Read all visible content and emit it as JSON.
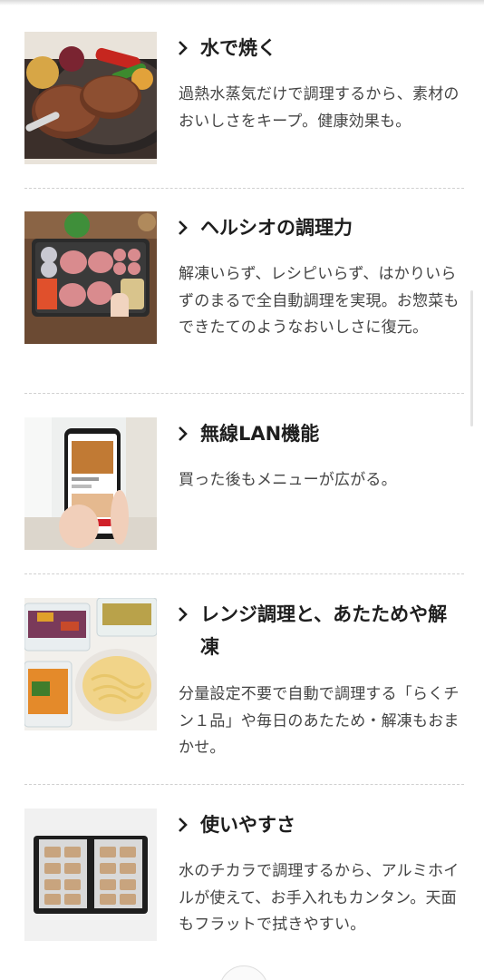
{
  "features": [
    {
      "title": "水で焼く",
      "image": "hamburg-steak-photo",
      "description": "過熱水蒸気だけで調理するから、素材のおいしさをキープ。健康効果も。"
    },
    {
      "title": "ヘルシオの調理力",
      "image": "tray-cooking-photo",
      "description": "解凍いらず、レシピいらず、はかりいらずのまるで全自動調理を実現。お惣菜もできたてのようなおいしさに復元。"
    },
    {
      "title": "無線LAN機能",
      "image": "smartphone-app-photo",
      "description": "買った後もメニューが広がる。"
    },
    {
      "title": "レンジ調理と、あたためや解凍",
      "image": "pasta-containers-photo",
      "description": "分量設定不要で自動で調理する「らくチン１品」や毎日のあたため・解凍もおまかせ。"
    },
    {
      "title": "使いやすさ",
      "image": "flat-tray-photo",
      "description": "水のチカラで調理するから、アルミホイルが使えて、お手入れもカンタン。天面もフラットで拭きやすい。"
    }
  ],
  "icons": {
    "chevron": "chevron-right-icon"
  },
  "colors": {
    "text": "#1e1e1e",
    "description": "#444444",
    "divider": "#d0d0d0"
  }
}
